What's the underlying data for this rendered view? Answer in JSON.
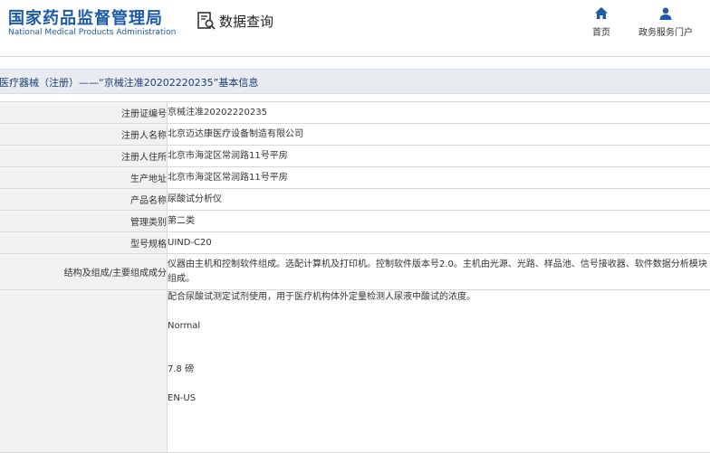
{
  "header": {
    "logo_cn": "国家药品监督管理局",
    "logo_en": "National Medical Products Administration",
    "query_label": "数据查询",
    "nav": {
      "home": "首页",
      "service": "政务服务门户"
    }
  },
  "breadcrumb": "医疗器械（注册）——“京械注准20202220235”基本信息",
  "rows": [
    {
      "label": "注册证编号",
      "value": "京械注准20202220235"
    },
    {
      "label": "注册人名称",
      "value": "北京迈达康医疗设备制造有限公司"
    },
    {
      "label": "注册人住所",
      "value": "北京市海淀区常润路11号平房"
    },
    {
      "label": "生产地址",
      "value": "北京市海淀区常润路11号平房"
    },
    {
      "label": "产品名称",
      "value": "尿酸试分析仪"
    },
    {
      "label": "管理类别",
      "value": "第二类"
    },
    {
      "label": "型号规格",
      "value": "UIND-C20"
    },
    {
      "label": "结构及组成/主要组成成分",
      "value": "仪器由主机和控制软件组成。选配计算机及打印机。控制软件版本号2.0。主机由光源、光路、样品池、信号接收器、软件数据分析模块组成。"
    }
  ],
  "description": {
    "line1": "配合尿酸试测定试剂使用，用于医疗机构体外定量检测人尿液中酸试的浓度。",
    "line2": "Normal",
    "line3": "7.8 磅",
    "line4": "EN-US"
  },
  "colors": {
    "brand": "#1c5aa8",
    "breadcrumb_bg": "#e8ebef",
    "label_bg": "#f1f1f1"
  }
}
